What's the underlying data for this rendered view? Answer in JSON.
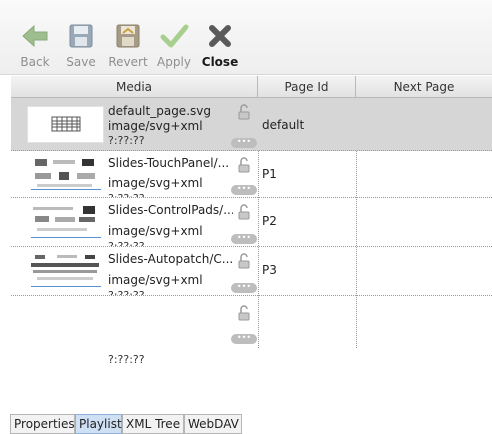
{
  "toolbar": {
    "back": "Back",
    "save": "Save",
    "revert": "Revert",
    "apply": "Apply",
    "close": "Close"
  },
  "columns": {
    "media": "Media",
    "page_id": "Page Id",
    "next_page": "Next Page"
  },
  "rows": [
    {
      "name": "default_page.svg",
      "type": "image/svg+xml",
      "time": "?:??:??",
      "page_id": "default",
      "more": "•••"
    },
    {
      "name": "Slides-TouchPanel/...",
      "type": "image/svg+xml",
      "time": "?:??:??",
      "page_id": "P1",
      "more": "•••"
    },
    {
      "name": "Slides-ControlPads/...",
      "type": "image/svg+xml",
      "time": "?:??:??",
      "page_id": "P2",
      "more": "•••"
    },
    {
      "name": "Slides-Autopatch/C...",
      "type": "image/svg+xml",
      "time": "?:??:??",
      "page_id": "P3",
      "more": "•••"
    },
    {
      "name": "",
      "type": "",
      "time": "?:??:??",
      "page_id": "",
      "more": "•••"
    }
  ],
  "tabs": [
    "Properties",
    "Playlist",
    "XML Tree",
    "WebDAV"
  ],
  "active_tab": "Playlist"
}
